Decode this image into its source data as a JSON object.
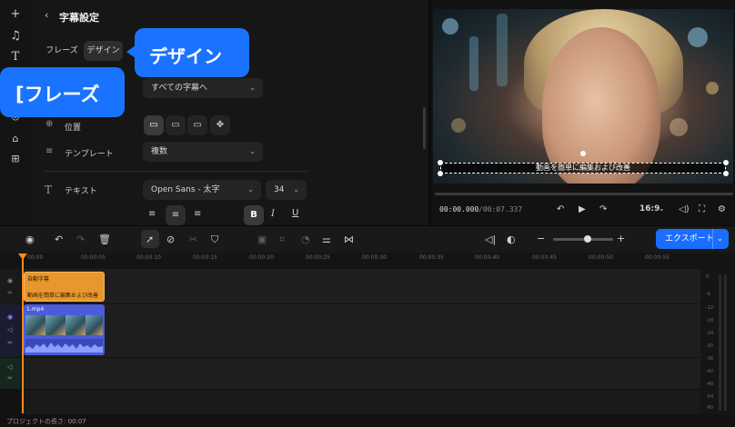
{
  "panel": {
    "back_icon": "‹",
    "title": "字幕設定",
    "tabs": [
      {
        "label": "フレーズ"
      },
      {
        "label": "デザイン"
      }
    ],
    "apply_scope": "すべての字幕へ",
    "position_label": "位置",
    "template_label": "テンプレート",
    "template_value": "複数",
    "text_label": "テキスト",
    "font_value": "Open Sans - 太字",
    "font_size": "34"
  },
  "callouts": {
    "design": "デザイン",
    "phrase": "[フレーズ"
  },
  "preview": {
    "subtitle_text": "動画を簡単に編集および改善",
    "timecode_current": "00:00.000",
    "timecode_total": "/00:07.337",
    "aspect_ratio": "16:9",
    "progress_fraction": 0.0
  },
  "toolbar": {
    "export_label": "エクスポート"
  },
  "timeline": {
    "ruler_ticks": [
      "00:00",
      "00:00:05",
      "00:00:10",
      "00:00:15",
      "00:00:20",
      "00:00:25",
      "00:00:30",
      "00:00:35",
      "00:00:40",
      "00:00:45",
      "00:00:50",
      "00:00:55"
    ],
    "subtitle_clip_title": "自動字幕",
    "subtitle_clip_text": "動画を簡単に編集および改善",
    "video_clip_title": "1.mp4",
    "meter_ticks": [
      "0",
      "-6",
      "-12",
      "-18",
      "-24",
      "-30",
      "-36",
      "-42",
      "-48",
      "-54",
      "-60"
    ],
    "project_length": "プロジェクトの長さ: 00:07"
  },
  "colors": {
    "accent": "#1a73ff",
    "subtitle_clip": "#e8962e",
    "video_clip": "#4b5cd8",
    "playhead": "#ff8a1c"
  }
}
